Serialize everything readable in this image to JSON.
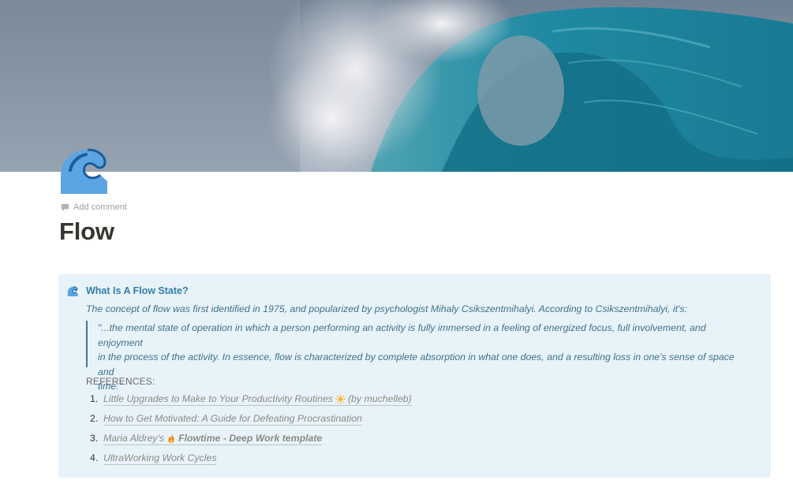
{
  "page": {
    "title": "Flow",
    "add_comment_label": "Add comment",
    "icon": "wave-icon",
    "cover": "ocean-wave-cover-image"
  },
  "callout": {
    "icon": "wave-icon",
    "background": "#e7f3f8",
    "heading_color": "#337ea9",
    "heading": "What Is A Flow State?",
    "intro": "The concept of flow was first identified in 1975, and popularized by psychologist Mihaly Csikszentmihalyi. According to Csikszentmihalyi, it's:",
    "quote_lines": [
      "\"...the mental state of operation in which a person performing an activity is fully immersed in a feeling of energized focus, full involvement, and enjoyment",
      "in the process of the activity. In essence, flow is characterized by complete absorption in what one does, and a resulting loss in one's sense of space and",
      "time.\""
    ],
    "references_label": "REFERENCES:",
    "references": [
      {
        "number": "1.",
        "text_before": "Little Upgrades to Make to Your Productivity Routines",
        "emoji": "sun-icon",
        "text_after": "(by muchelleb)"
      },
      {
        "number": "2.",
        "text": "How to Get Motivated: A Guide for Defeating Procrastination"
      },
      {
        "number": "3.",
        "text_before": "Maria Aldrey's",
        "emoji": "fire-icon",
        "text_bold": "Flowtime - Deep Work template"
      },
      {
        "number": "4.",
        "text": "UltraWorking Work Cycles"
      }
    ]
  }
}
